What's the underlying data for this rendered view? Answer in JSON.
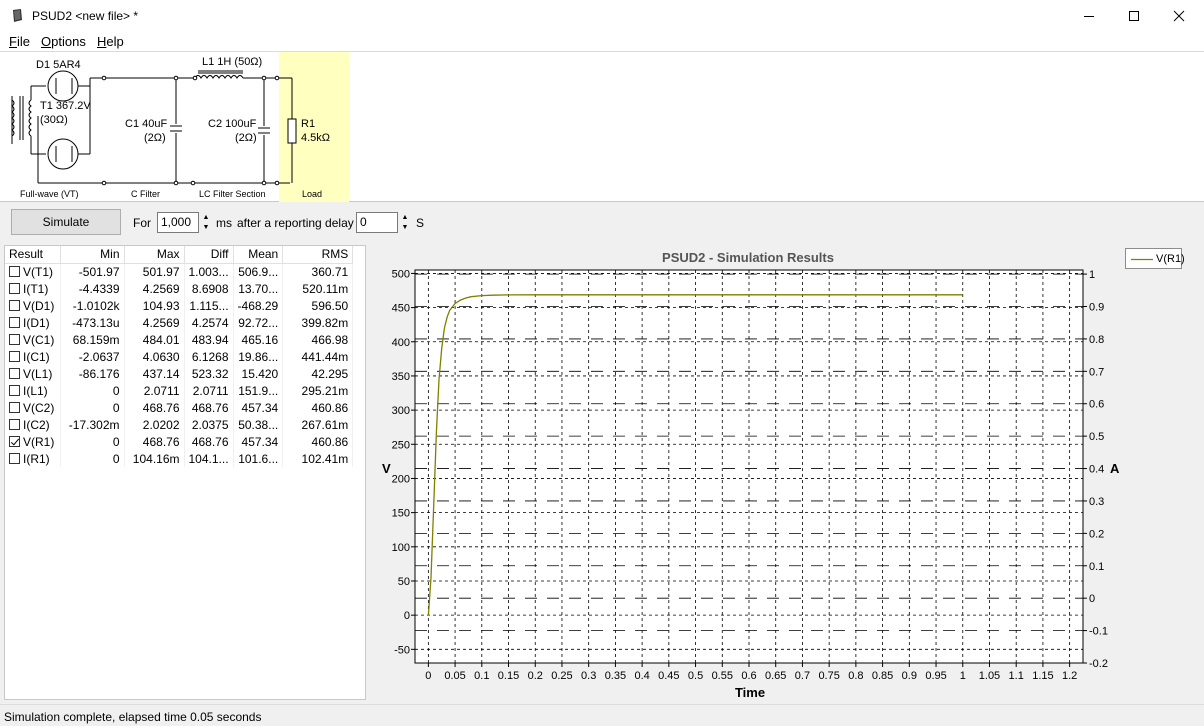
{
  "window": {
    "title": "PSUD2  <new file> *"
  },
  "menu": [
    {
      "label": "File",
      "u": "F",
      "rest": "ile"
    },
    {
      "label": "Options",
      "u": "O",
      "rest": "ptions"
    },
    {
      "label": "Help",
      "u": "H",
      "rest": "elp"
    }
  ],
  "circuit": {
    "d1_label": "D1 5AR4",
    "t1_label": "T1 367.2V",
    "t1_res": "(30Ω)",
    "l1_label": "L1 1H (50Ω)",
    "c1_label": "C1 40uF",
    "c1_res": "(2Ω)",
    "c2_label": "C2 100uF",
    "c2_res": "(2Ω)",
    "r1_label": "R1",
    "r1_value": "4.5kΩ",
    "sections": [
      "Full-wave (VT)",
      "C Filter",
      "LC Filter Section",
      "Load"
    ]
  },
  "sim_controls": {
    "simulate_label": "Simulate",
    "for_label": "For",
    "duration": "1,000",
    "ms_label": "ms",
    "delay_label": "after a reporting delay of",
    "delay": "0",
    "s_label": "S"
  },
  "results": {
    "headers": [
      "Result",
      "Min",
      "Max",
      "Diff",
      "Mean",
      "RMS"
    ],
    "rows": [
      {
        "name": "V(T1)",
        "checked": false,
        "min": "-501.97",
        "max": "501.97",
        "diff": "1.003...",
        "mean": "506.9...",
        "rms": "360.71"
      },
      {
        "name": "I(T1)",
        "checked": false,
        "min": "-4.4339",
        "max": "4.2569",
        "diff": "8.6908",
        "mean": "13.70...",
        "rms": "520.11m"
      },
      {
        "name": "V(D1)",
        "checked": false,
        "min": "-1.0102k",
        "max": "104.93",
        "diff": "1.115...",
        "mean": "-468.29",
        "rms": "596.50"
      },
      {
        "name": "I(D1)",
        "checked": false,
        "min": "-473.13u",
        "max": "4.2569",
        "diff": "4.2574",
        "mean": "92.72...",
        "rms": "399.82m"
      },
      {
        "name": "V(C1)",
        "checked": false,
        "min": "68.159m",
        "max": "484.01",
        "diff": "483.94",
        "mean": "465.16",
        "rms": "466.98"
      },
      {
        "name": "I(C1)",
        "checked": false,
        "min": "-2.0637",
        "max": "4.0630",
        "diff": "6.1268",
        "mean": "19.86...",
        "rms": "441.44m"
      },
      {
        "name": "V(L1)",
        "checked": false,
        "min": "-86.176",
        "max": "437.14",
        "diff": "523.32",
        "mean": "15.420",
        "rms": "42.295"
      },
      {
        "name": "I(L1)",
        "checked": false,
        "min": "0",
        "max": "2.0711",
        "diff": "2.0711",
        "mean": "151.9...",
        "rms": "295.21m"
      },
      {
        "name": "V(C2)",
        "checked": false,
        "min": "0",
        "max": "468.76",
        "diff": "468.76",
        "mean": "457.34",
        "rms": "460.86"
      },
      {
        "name": "I(C2)",
        "checked": false,
        "min": "-17.302m",
        "max": "2.0202",
        "diff": "2.0375",
        "mean": "50.38...",
        "rms": "267.61m"
      },
      {
        "name": "V(R1)",
        "checked": true,
        "min": "0",
        "max": "468.76",
        "diff": "468.76",
        "mean": "457.34",
        "rms": "460.86"
      },
      {
        "name": "I(R1)",
        "checked": false,
        "min": "0",
        "max": "104.16m",
        "diff": "104.1...",
        "mean": "101.6...",
        "rms": "102.41m"
      }
    ]
  },
  "chart_data": {
    "type": "line",
    "title": "PSUD2 - Simulation Results",
    "xlabel": "Time",
    "ylabel": "V",
    "y2label": "A",
    "xlim": [
      -0.025,
      1.225
    ],
    "ylim": [
      -70,
      505
    ],
    "y2lim": [
      -0.2,
      1
    ],
    "x_ticks": [
      0,
      0.05,
      0.1,
      0.15,
      0.2,
      0.25,
      0.3,
      0.35,
      0.4,
      0.45,
      0.5,
      0.55,
      0.6,
      0.65,
      0.7,
      0.75,
      0.8,
      0.85,
      0.9,
      0.95,
      1,
      1.05,
      1.1,
      1.15,
      1.2
    ],
    "x_tick_labels": [
      "0",
      "0.05",
      "0.1",
      "0.15",
      "0.2",
      "0.25",
      "0.3",
      "0.35",
      "0.4",
      "0.45",
      "0.5",
      "0.55",
      "0.6",
      "0.65",
      "0.7",
      "0.75",
      "0.8",
      "0.85",
      "0.9",
      "0.95",
      "1",
      "1.05",
      "1.1",
      "1.15",
      "1.2"
    ],
    "y_ticks": [
      -50,
      0,
      50,
      100,
      150,
      200,
      250,
      300,
      350,
      400,
      450,
      500
    ],
    "y_tick_labels": [
      "-50",
      "0",
      "50",
      "100",
      "150",
      "200",
      "250",
      "300",
      "350",
      "400",
      "450",
      "500"
    ],
    "y2_ticks": [
      -0.2,
      -0.1,
      0,
      0.1,
      0.2,
      0.3,
      0.4,
      0.5,
      0.6,
      0.7,
      0.8,
      0.9,
      1
    ],
    "y2_tick_labels": [
      "-0.2",
      "-0.1",
      "0",
      "0.1",
      "0.2",
      "0.3",
      "0.4",
      "0.5",
      "0.6",
      "0.7",
      "0.8",
      "0.9",
      "1"
    ],
    "grid": true,
    "legend": "top-right",
    "series": [
      {
        "name": "V(R1)",
        "color": "#7f7f00",
        "x": [
          0,
          0.005,
          0.01,
          0.015,
          0.02,
          0.025,
          0.03,
          0.035,
          0.04,
          0.05,
          0.06,
          0.07,
          0.08,
          0.1,
          0.12,
          0.15,
          0.2,
          0.3,
          0.5,
          0.75,
          1.0
        ],
        "y": [
          0,
          55,
          160,
          268,
          345,
          390,
          420,
          436,
          446,
          456,
          461,
          464,
          466,
          467.5,
          468.2,
          468.6,
          468.7,
          468.76,
          468.76,
          468.76,
          468.76
        ]
      }
    ]
  },
  "colors": {
    "load_highlight": "#ffffc0",
    "series": "#7f7f00"
  },
  "status": {
    "text": "Simulation complete, elapsed time 0.05 seconds"
  }
}
